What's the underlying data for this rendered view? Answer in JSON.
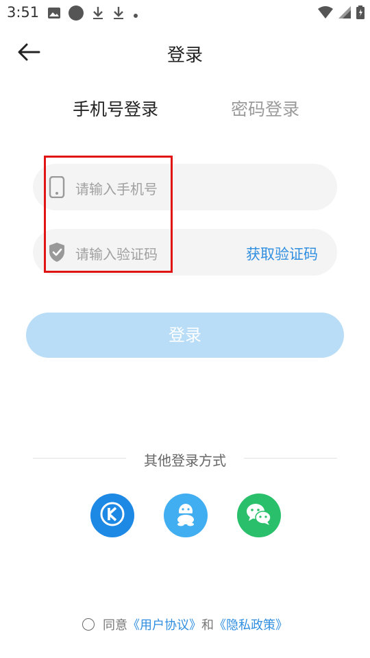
{
  "status_bar": {
    "time": "3:51"
  },
  "header": {
    "title": "登录"
  },
  "tabs": {
    "phone_login": "手机号登录",
    "password_login": "密码登录"
  },
  "form": {
    "phone_placeholder": "请输入手机号",
    "code_placeholder": "请输入验证码",
    "get_code": "获取验证码"
  },
  "login_button": "登录",
  "other_login": {
    "label": "其他登录方式"
  },
  "agreement": {
    "prefix": "同意",
    "user_agreement": "《用户协议》",
    "and": "和",
    "privacy_policy": "《隐私政策》"
  },
  "colors": {
    "accent": "#2f8ee0",
    "login_button_disabled": "#b9ddf7",
    "highlight": "#e21313"
  }
}
